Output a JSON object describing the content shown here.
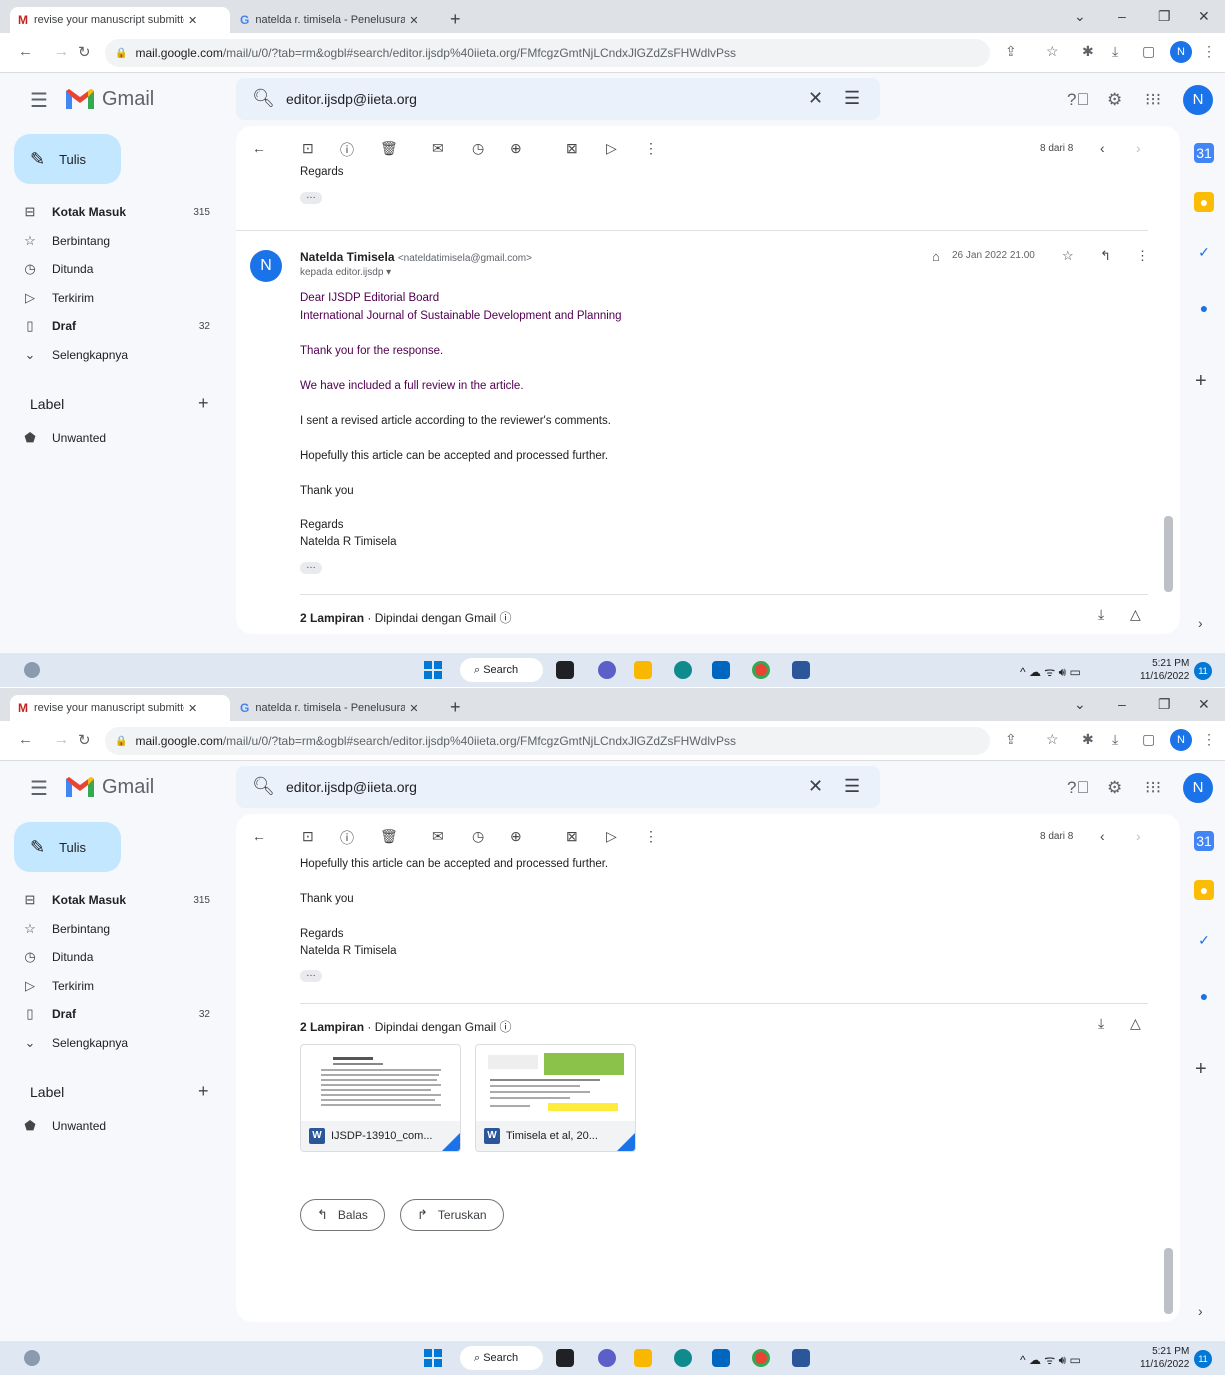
{
  "tabs": [
    {
      "title": "revise your manuscript submitted",
      "favicon": "M"
    },
    {
      "title": "natelda r. timisela - Penelusuran",
      "favicon": "G"
    }
  ],
  "url": {
    "host": "mail.google.com",
    "path": "/mail/u/0/?tab=rm&ogbl#search/editor.ijsdp%40iieta.org/FMfcgzGmtNjLCndxJlGZdZsFHWdlvPss"
  },
  "profile_initial": "N",
  "gmail": {
    "name": "Gmail"
  },
  "search": {
    "query": "editor.ijsdp@iieta.org"
  },
  "sidebar": {
    "compose": "Tulis",
    "items": [
      {
        "label": "Kotak Masuk",
        "count": "315",
        "icon": "inbox-icon"
      },
      {
        "label": "Berbintang",
        "count": "",
        "icon": "star-icon"
      },
      {
        "label": "Ditunda",
        "count": "",
        "icon": "clock-icon"
      },
      {
        "label": "Terkirim",
        "count": "",
        "icon": "send-icon"
      },
      {
        "label": "Draf",
        "count": "32",
        "icon": "draft-icon"
      },
      {
        "label": "Selengkapnya",
        "count": "",
        "icon": "chevron-down-icon"
      }
    ],
    "label_heading": "Label",
    "labels": [
      {
        "label": "Unwanted"
      }
    ]
  },
  "pager": "8 dari 8",
  "message": {
    "prev_sign": "Regards",
    "sender_name": "Natelda Timisela",
    "sender_email": "<nateldatimisela@gmail.com>",
    "to": "kepada editor.ijsdp",
    "date": "26 Jan 2022 21.00",
    "body": {
      "greeting1": "Dear IJSDP Editorial Board",
      "greeting2": "International Journal of Sustainable Development and Planning",
      "p1": "Thank you for the response.",
      "p2": "We have included a full review in the article.",
      "p3": "I sent a revised article according to the reviewer's comments.",
      "p4": "Hopefully this article can be accepted and processed further.",
      "p5": "Thank you",
      "sign1": "Regards",
      "sign2": "Natelda R Timisela"
    },
    "attachments_count": "2 Lampiran",
    "attachments_scan": "Dipindai dengan Gmail",
    "attachments": [
      {
        "name": "IJSDP-13910_com...",
        "type": "W"
      },
      {
        "name": "Timisela et al, 20...",
        "type": "W"
      }
    ],
    "reply": "Balas",
    "forward": "Teruskan"
  },
  "taskbar": {
    "search": "Search",
    "time": "5:21 PM",
    "date": "11/16/2022",
    "notifications": "11"
  }
}
